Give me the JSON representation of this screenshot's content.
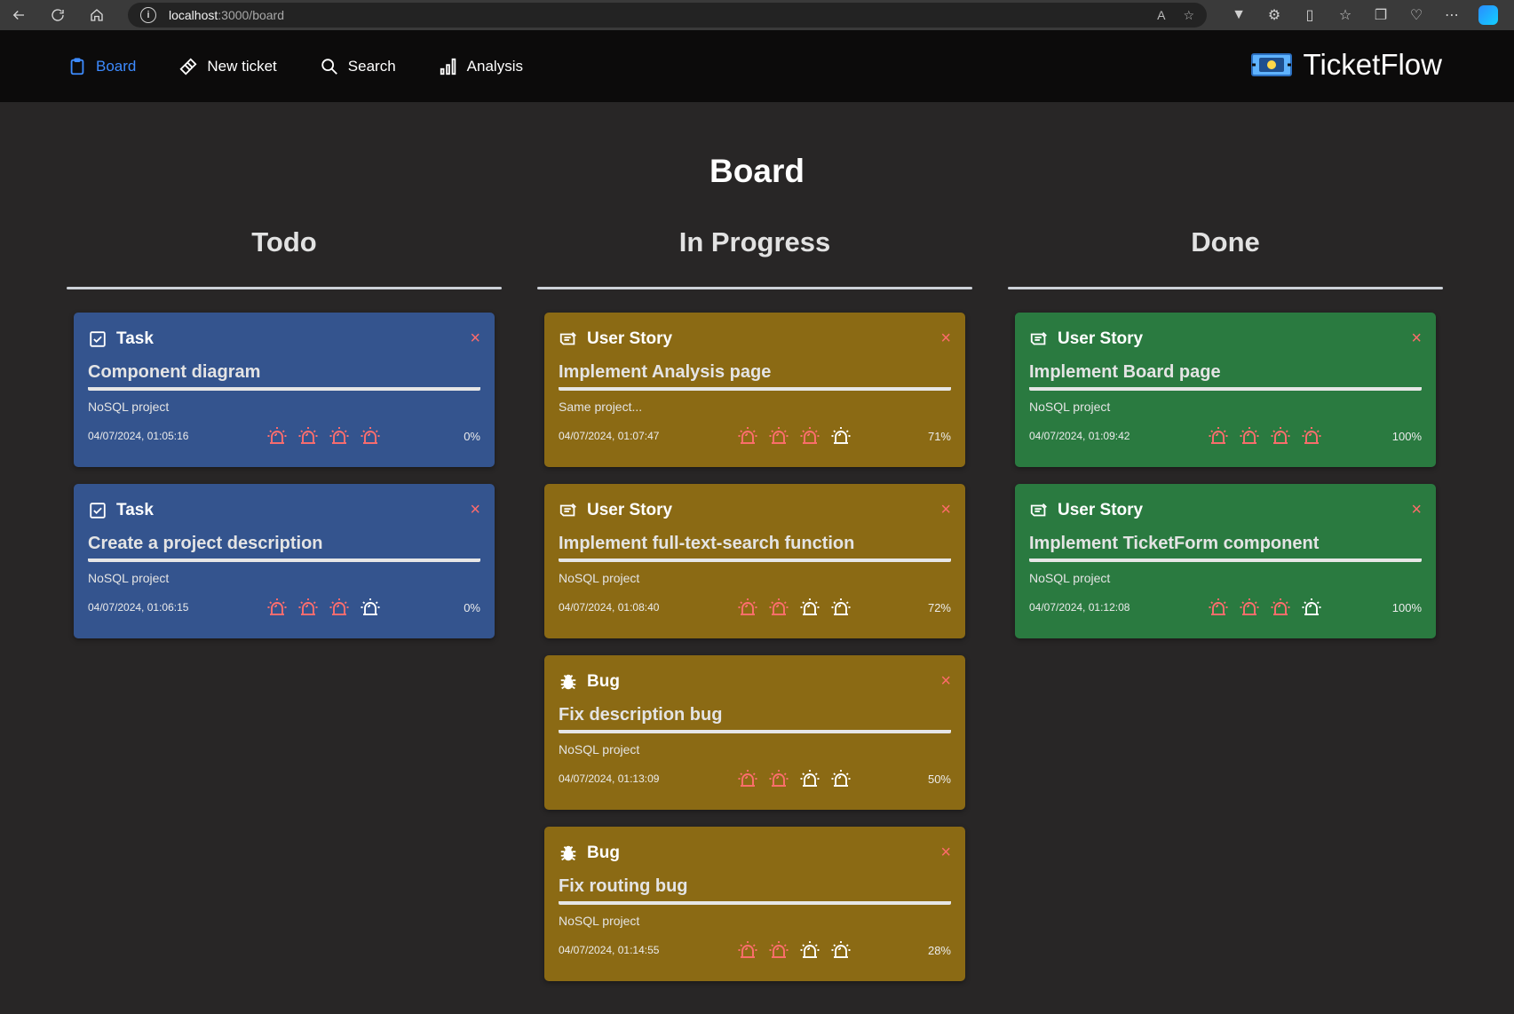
{
  "browser": {
    "url_host": "localhost",
    "url_path": ":3000/board"
  },
  "nav": {
    "items": [
      {
        "label": "Board",
        "icon": "clipboard-icon",
        "active": true
      },
      {
        "label": "New ticket",
        "icon": "ticket-icon",
        "active": false
      },
      {
        "label": "Search",
        "icon": "search-icon",
        "active": false
      },
      {
        "label": "Analysis",
        "icon": "bar-chart-icon",
        "active": false
      }
    ],
    "brand": "TicketFlow"
  },
  "page": {
    "title": "Board"
  },
  "columns": [
    {
      "title": "Todo",
      "cards": [
        {
          "type": "Task",
          "title": "Component diagram",
          "description": "NoSQL project",
          "date": "04/07/2024, 01:05:16",
          "priority": 4,
          "progress": "0%"
        },
        {
          "type": "Task",
          "title": "Create a project description",
          "description": "NoSQL project",
          "date": "04/07/2024, 01:06:15",
          "priority": 3,
          "progress": "0%"
        }
      ]
    },
    {
      "title": "In Progress",
      "cards": [
        {
          "type": "User Story",
          "title": "Implement Analysis page",
          "description": "Same project...",
          "date": "04/07/2024, 01:07:47",
          "priority": 3,
          "progress": "71%"
        },
        {
          "type": "User Story",
          "title": "Implement full-text-search function",
          "description": "NoSQL project",
          "date": "04/07/2024, 01:08:40",
          "priority": 2,
          "progress": "72%"
        },
        {
          "type": "Bug",
          "title": "Fix description bug",
          "description": "NoSQL project",
          "date": "04/07/2024, 01:13:09",
          "priority": 2,
          "progress": "50%"
        },
        {
          "type": "Bug",
          "title": "Fix routing bug",
          "description": "NoSQL project",
          "date": "04/07/2024, 01:14:55",
          "priority": 2,
          "progress": "28%"
        }
      ]
    },
    {
      "title": "Done",
      "cards": [
        {
          "type": "User Story",
          "title": "Implement Board page",
          "description": "NoSQL project",
          "date": "04/07/2024, 01:09:42",
          "priority": 4,
          "progress": "100%"
        },
        {
          "type": "User Story",
          "title": "Implement TicketForm component",
          "description": "NoSQL project",
          "date": "04/07/2024, 01:12:08",
          "priority": 3,
          "progress": "100%"
        }
      ]
    }
  ],
  "card_close_glyph": "×",
  "colors": {
    "todo": "#34548e",
    "in_progress": "#8b6a14",
    "done": "#2a7a40",
    "accent": "#3d8bff",
    "alarm_on": "#ff6e6e"
  }
}
